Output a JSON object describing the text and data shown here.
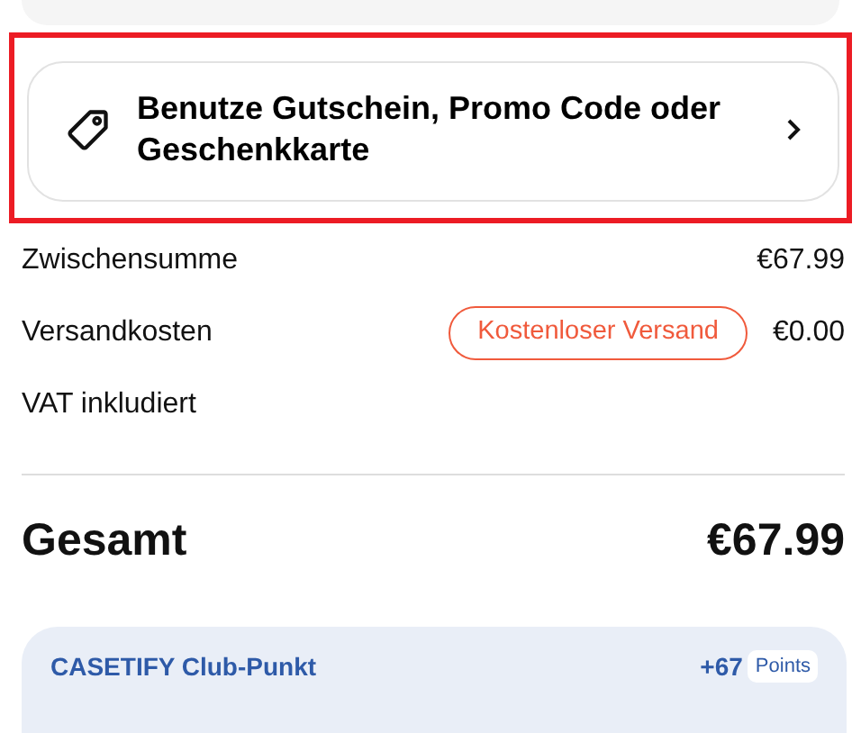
{
  "promo": {
    "label": "Benutze Gutschein, Promo Code oder Geschenkkarte",
    "highlighted": true
  },
  "summary": [
    {
      "label": "Zwischensumme",
      "value": "€67.99"
    },
    {
      "label": "Versandkosten",
      "tag": "Kostenloser Versand",
      "value": "€0.00"
    },
    {
      "label": "VAT inkludiert"
    }
  ],
  "total": {
    "label": "Gesamt",
    "value": "€67.99"
  },
  "club": {
    "title": "CASETIFY Club-Punkt",
    "points": "+67",
    "unit": "Points"
  }
}
